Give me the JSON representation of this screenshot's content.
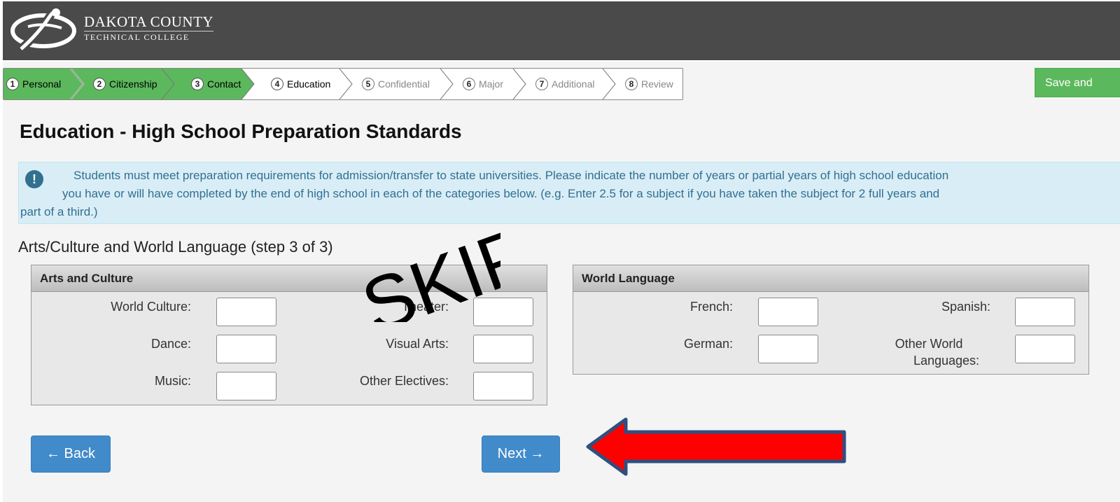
{
  "header": {
    "logo_line1": "DAKOTA COUNTY",
    "logo_line2": "TECHNICAL COLLEGE"
  },
  "steps": [
    {
      "num": "1",
      "label": "Personal",
      "state": "done"
    },
    {
      "num": "2",
      "label": "Citizenship",
      "state": "done"
    },
    {
      "num": "3",
      "label": "Contact",
      "state": "done"
    },
    {
      "num": "4",
      "label": "Education",
      "state": "current"
    },
    {
      "num": "5",
      "label": "Confidential",
      "state": "todo"
    },
    {
      "num": "6",
      "label": "Major",
      "state": "todo"
    },
    {
      "num": "7",
      "label": "Additional",
      "state": "todo"
    },
    {
      "num": "8",
      "label": "Review",
      "state": "todo"
    }
  ],
  "save_label": "Save and",
  "page_title": "Education - High School Preparation Standards",
  "info": {
    "icon": "!",
    "line1": "Students must meet preparation requirements for admission/transfer to state universities. Please indicate the number of years or partial years of high school education",
    "line2": "you have or will have completed by the end of high school in each of the categories below. (e.g. Enter 2.5 for a subject if you have taken the subject for 2 full years and",
    "line3": "part of a third.)"
  },
  "section_title": "Arts/Culture and World Language (step 3 of 3)",
  "arts": {
    "title": "Arts and Culture",
    "fields": {
      "world_culture": {
        "label": "World Culture:",
        "value": ""
      },
      "theater": {
        "label": "Theater:",
        "value": ""
      },
      "dance": {
        "label": "Dance:",
        "value": ""
      },
      "visual_arts": {
        "label": "Visual Arts:",
        "value": ""
      },
      "music": {
        "label": "Music:",
        "value": ""
      },
      "other_electives": {
        "label": "Other Electives:",
        "value": ""
      }
    }
  },
  "language": {
    "title": "World Language",
    "fields": {
      "french": {
        "label": "French:",
        "value": ""
      },
      "spanish": {
        "label": "Spanish:",
        "value": ""
      },
      "german": {
        "label": "German:",
        "value": ""
      },
      "other_l1": "Other World",
      "other_l2": "Languages:",
      "other_value": ""
    }
  },
  "buttons": {
    "back": "← Back",
    "next": "Next →"
  },
  "annotation": {
    "text": "SKIP",
    "arrow_color": "#ff0000"
  },
  "colors": {
    "header_bg": "#4a4a4a",
    "step_done": "#5cb85c",
    "info_bg": "#d9edf7",
    "primary": "#428bca"
  }
}
